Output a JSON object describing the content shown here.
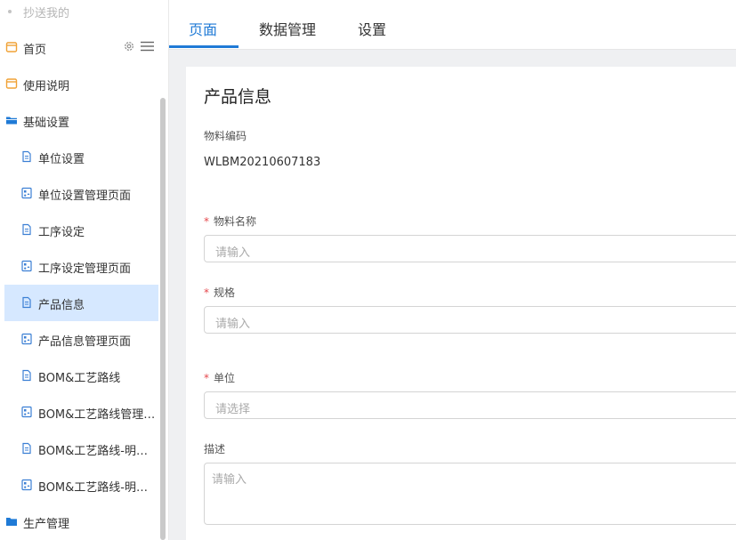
{
  "sidebar": {
    "top_item": "抄送我的",
    "home": "首页",
    "guide": "使用说明",
    "basic_settings": "基础设置",
    "sub_items": [
      {
        "label": "单位设置",
        "icon": "doc"
      },
      {
        "label": "单位设置管理页面",
        "icon": "form"
      },
      {
        "label": "工序设定",
        "icon": "doc"
      },
      {
        "label": "工序设定管理页面",
        "icon": "form"
      },
      {
        "label": "产品信息",
        "icon": "doc"
      },
      {
        "label": "产品信息管理页面",
        "icon": "form"
      },
      {
        "label": "BOM&工艺路线",
        "icon": "doc"
      },
      {
        "label": "BOM&工艺路线管理页面",
        "icon": "form"
      },
      {
        "label": "BOM&工艺路线-明细统计",
        "icon": "doc"
      },
      {
        "label": "BOM&工艺路线-明细统计管理页面",
        "icon": "form"
      }
    ],
    "production": "生产管理",
    "active_index": 4
  },
  "tabs": [
    {
      "label": "页面"
    },
    {
      "label": "数据管理"
    },
    {
      "label": "设置"
    }
  ],
  "form": {
    "title": "产品信息",
    "code_label": "物料编码",
    "code_value": "WLBM20210607183",
    "name_label": "物料名称",
    "name_placeholder": "请输入",
    "spec_label": "规格",
    "spec_placeholder": "请输入",
    "unit_label": "单位",
    "unit_placeholder": "请选择",
    "desc_label": "描述",
    "desc_placeholder": "请输入",
    "required_mark": "*"
  },
  "colors": {
    "accent": "#1f7ad6",
    "active_bg": "#d6e8ff",
    "required": "#e5484d",
    "folder_orange": "#f0a236"
  }
}
